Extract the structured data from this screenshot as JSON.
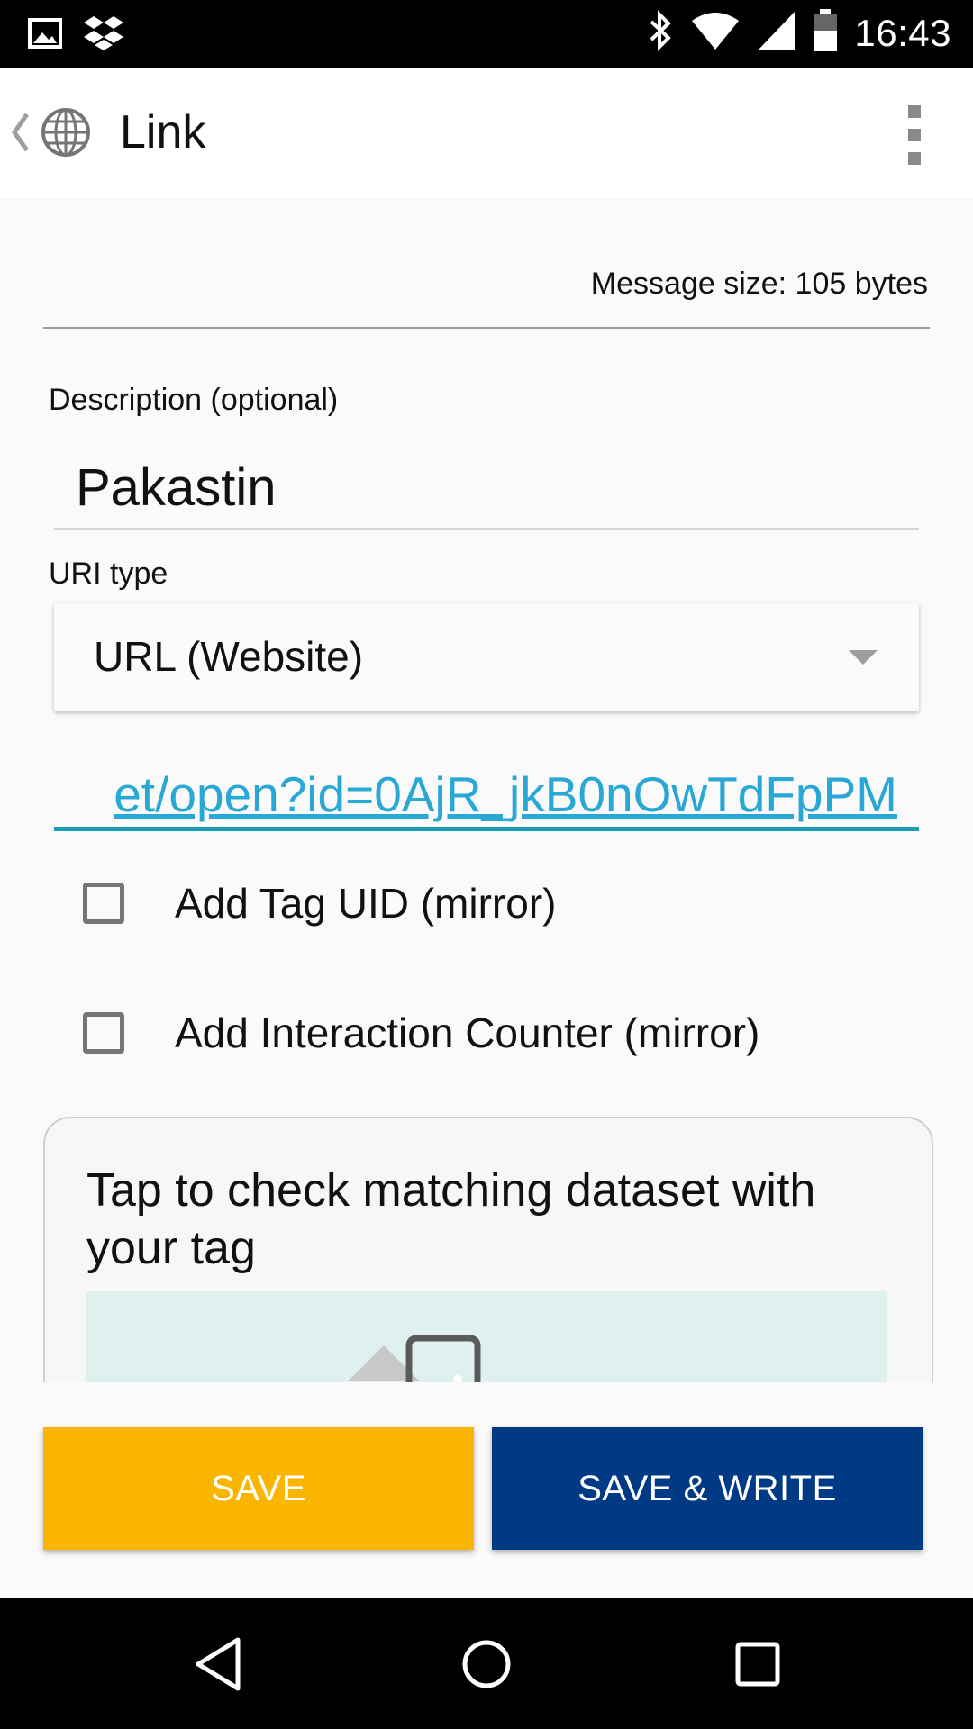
{
  "status_bar": {
    "time": "16:43",
    "left_icons": [
      "image-icon",
      "dropbox-icon"
    ],
    "right_icons": [
      "bluetooth-icon",
      "wifi-icon",
      "signal-icon",
      "battery-icon"
    ]
  },
  "app_bar": {
    "title": "Link",
    "icons": [
      "back-chevron-icon",
      "globe-icon",
      "more-vert-icon"
    ]
  },
  "message_size": "Message size: 105 bytes",
  "description": {
    "label": "Description (optional)",
    "value": "Pakastin"
  },
  "uri_type": {
    "label": "URI type",
    "selected": "URL (Website)"
  },
  "url_field": {
    "value": "et/open?id=0AjR_jkB0nOwTdFpPM"
  },
  "checkboxes": [
    {
      "label": "Add Tag UID (mirror)",
      "checked": false
    },
    {
      "label": "Add Interaction Counter (mirror)",
      "checked": false
    }
  ],
  "card": {
    "text": "Tap to check matching dataset with your tag"
  },
  "buttons": {
    "save": "SAVE",
    "save_write": "SAVE & WRITE"
  },
  "colors": {
    "save": "#f9b500",
    "save_write": "#003a85",
    "url_text": "#29a8d6",
    "url_underline": "#1b9db2"
  },
  "nav_icons": [
    "back-triangle-icon",
    "home-circle-icon",
    "recents-square-icon"
  ]
}
